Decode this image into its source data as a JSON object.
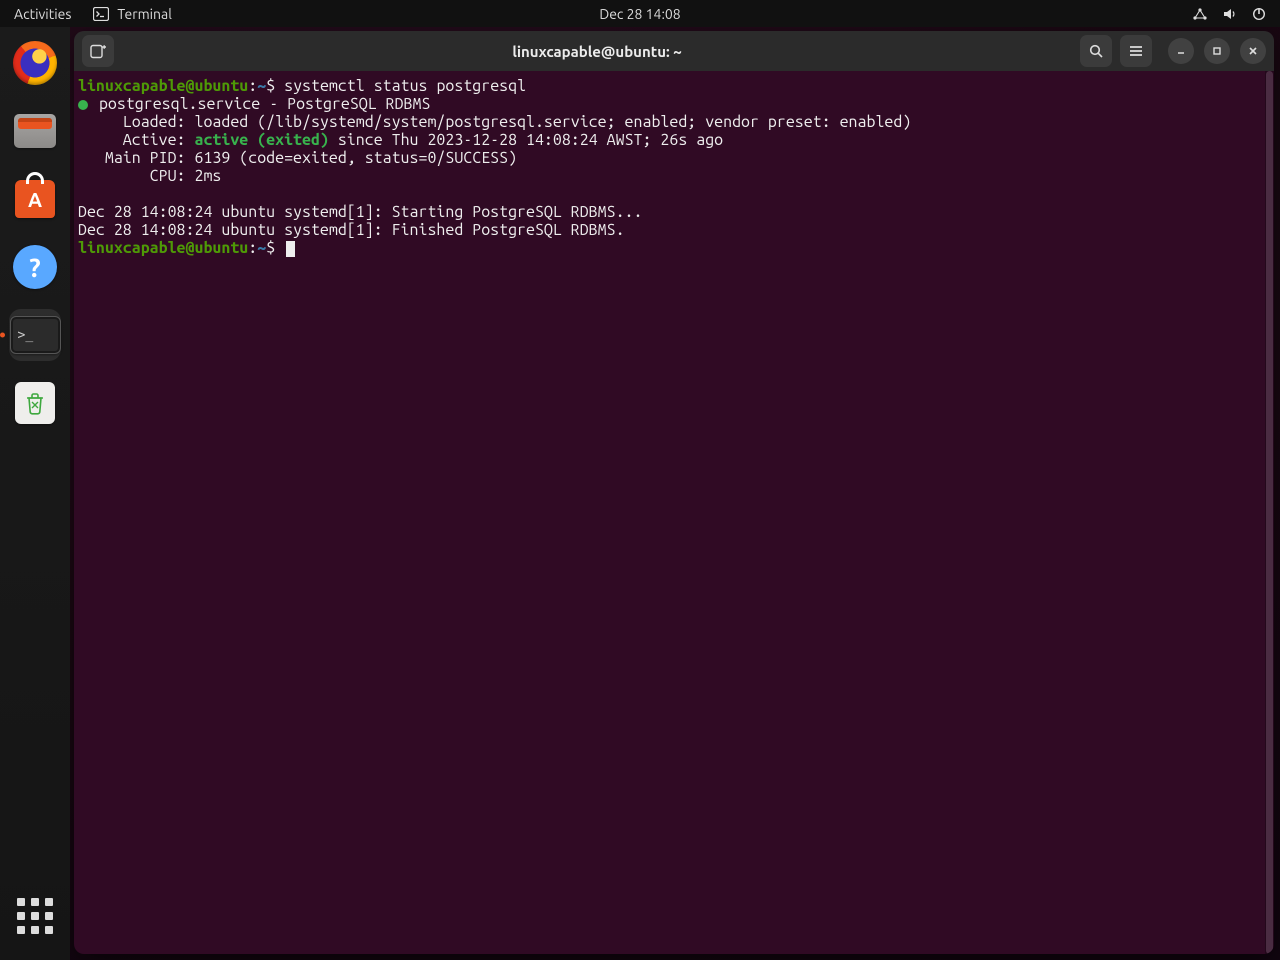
{
  "top_panel": {
    "activities": "Activities",
    "app_label": "Terminal",
    "clock": "Dec 28  14:08"
  },
  "dock": {
    "firefox": "Firefox",
    "files": "Files",
    "software": "Ubuntu Software",
    "help": "Help",
    "terminal": "Terminal",
    "trash": "Trash",
    "apps": "Show Applications"
  },
  "window": {
    "title": "linuxcapable@ubuntu: ~"
  },
  "prompt": {
    "user": "linuxcapable@ubuntu",
    "sep": ":",
    "path": "~",
    "sym": "$"
  },
  "terminal": {
    "cmd1": "systemctl status postgresql",
    "line_service": " postgresql.service - PostgreSQL RDBMS",
    "line_loaded": "     Loaded: loaded (/lib/systemd/system/postgresql.service; enabled; vendor preset: enabled)",
    "line_active_prefix": "     Active: ",
    "line_active_state": "active (exited)",
    "line_active_suffix": " since Thu 2023-12-28 14:08:24 AWST; 26s ago",
    "line_mainpid": "   Main PID: 6139 (code=exited, status=0/SUCCESS)",
    "line_cpu": "        CPU: 2ms",
    "log1": "Dec 28 14:08:24 ubuntu systemd[1]: Starting PostgreSQL RDBMS...",
    "log2": "Dec 28 14:08:24 ubuntu systemd[1]: Finished PostgreSQL RDBMS."
  }
}
